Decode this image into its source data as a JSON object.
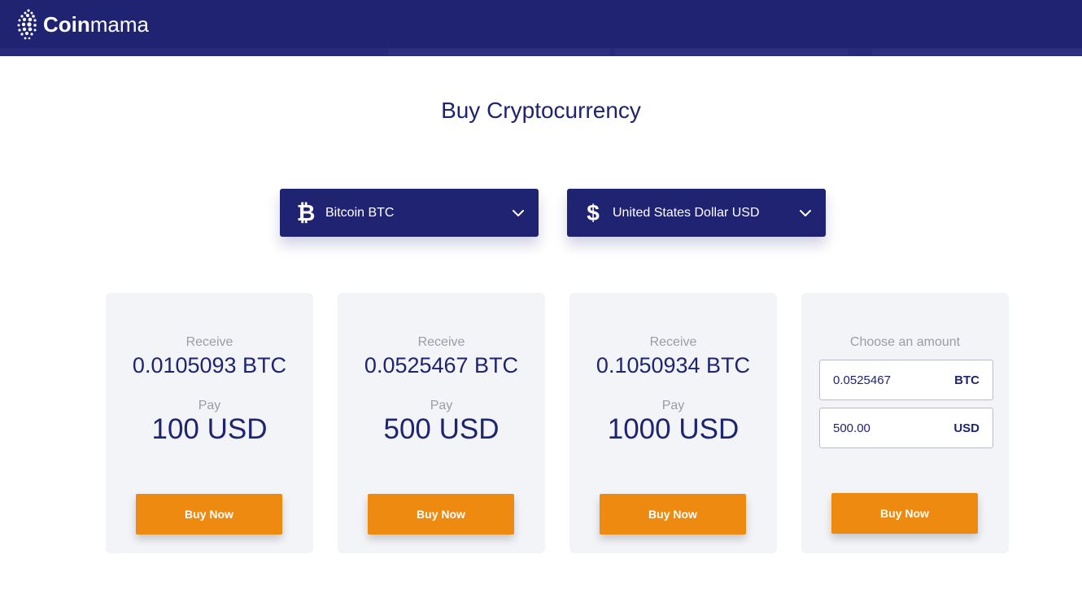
{
  "brand": {
    "name_bold": "Coin",
    "name_light": "mama",
    "logo_icon": "coinmama-logo-icon"
  },
  "page": {
    "title": "Buy Cryptocurrency"
  },
  "selectors": {
    "crypto": {
      "icon": "bitcoin-icon",
      "glyph": "₿",
      "label": "Bitcoin BTC"
    },
    "fiat": {
      "icon": "dollar-icon",
      "glyph": "$",
      "label": "United States Dollar USD"
    }
  },
  "packages": [
    {
      "receive_label": "Receive",
      "receive_value": "0.0105093 BTC",
      "pay_label": "Pay",
      "pay_value": "100 USD",
      "button": "Buy Now"
    },
    {
      "receive_label": "Receive",
      "receive_value": "0.0525467 BTC",
      "pay_label": "Pay",
      "pay_value": "500 USD",
      "button": "Buy Now"
    },
    {
      "receive_label": "Receive",
      "receive_value": "0.1050934 BTC",
      "pay_label": "Pay",
      "pay_value": "1000 USD",
      "button": "Buy Now"
    }
  ],
  "custom": {
    "label": "Choose an amount",
    "crypto_amount": "0.0525467",
    "crypto_unit": "BTC",
    "fiat_amount": "500.00",
    "fiat_unit": "USD",
    "button": "Buy Now"
  },
  "colors": {
    "primary": "#1f2372",
    "accent": "#ee8a0f",
    "card_bg": "#f3f4f8",
    "muted_text": "#9a9ca6"
  }
}
